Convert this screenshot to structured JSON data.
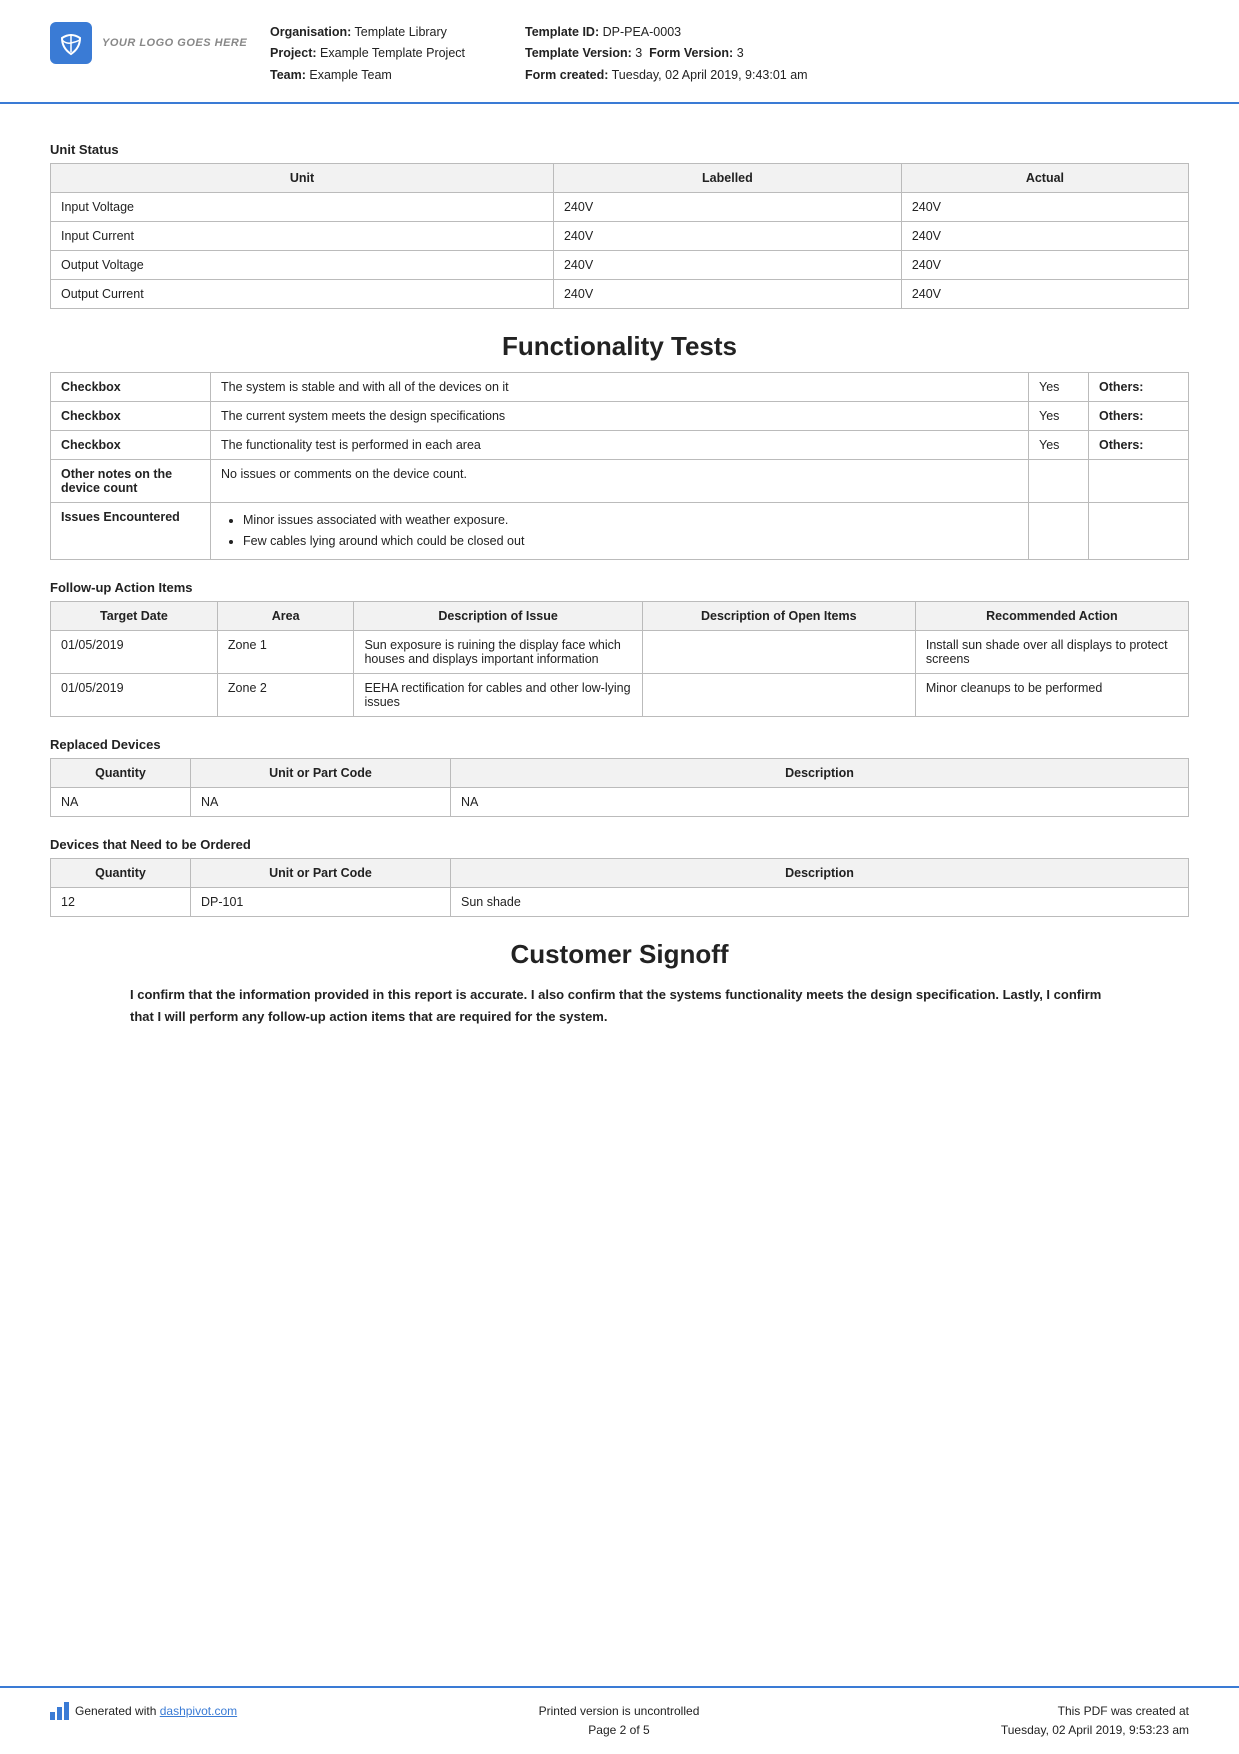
{
  "header": {
    "logo_text": "YOUR LOGO GOES HERE",
    "org_label": "Organisation:",
    "org_value": "Template Library",
    "project_label": "Project:",
    "project_value": "Example Template Project",
    "team_label": "Team:",
    "team_value": "Example Team",
    "template_id_label": "Template ID:",
    "template_id_value": "DP-PEA-0003",
    "template_version_label": "Template Version:",
    "template_version_value": "3",
    "form_version_label": "Form Version:",
    "form_version_value": "3",
    "form_created_label": "Form created:",
    "form_created_value": "Tuesday, 02 April 2019, 9:43:01 am"
  },
  "unit_status": {
    "section_title": "Unit Status",
    "columns": [
      "Unit",
      "Labelled",
      "Actual"
    ],
    "rows": [
      [
        "Input Voltage",
        "240V",
        "240V"
      ],
      [
        "Input Current",
        "240V",
        "240V"
      ],
      [
        "Output Voltage",
        "240V",
        "240V"
      ],
      [
        "Output Current",
        "240V",
        "240V"
      ]
    ]
  },
  "functionality_tests": {
    "heading": "Functionality Tests",
    "rows": [
      {
        "label": "Checkbox",
        "description": "The system is stable and with all of the devices on it",
        "value": "Yes",
        "others_label": "Others:"
      },
      {
        "label": "Checkbox",
        "description": "The current system meets the design specifications",
        "value": "Yes",
        "others_label": "Others:"
      },
      {
        "label": "Checkbox",
        "description": "The functionality test is performed in each area",
        "value": "Yes",
        "others_label": "Others:"
      },
      {
        "label": "Other notes on the device count",
        "description": "No issues or comments on the device count.",
        "value": "",
        "others_label": ""
      },
      {
        "label": "Issues Encountered",
        "description": "",
        "value": "",
        "others_label": "",
        "bullets": [
          "Minor issues associated with weather exposure.",
          "Few cables lying around which could be closed out"
        ]
      }
    ]
  },
  "followup": {
    "section_title": "Follow-up Action Items",
    "columns": [
      "Target Date",
      "Area",
      "Description of Issue",
      "Description of Open Items",
      "Recommended Action"
    ],
    "rows": [
      {
        "date": "01/05/2019",
        "area": "Zone 1",
        "issue": "Sun exposure is ruining the display face which houses and displays important information",
        "open_items": "",
        "action": "Install sun shade over all displays to protect screens"
      },
      {
        "date": "01/05/2019",
        "area": "Zone 2",
        "issue": "EEHA rectification for cables and other low-lying issues",
        "open_items": "",
        "action": "Minor cleanups to be performed"
      }
    ]
  },
  "replaced_devices": {
    "section_title": "Replaced Devices",
    "columns": [
      "Quantity",
      "Unit or Part Code",
      "Description"
    ],
    "rows": [
      [
        "NA",
        "NA",
        "NA"
      ]
    ]
  },
  "devices_to_order": {
    "section_title": "Devices that Need to be Ordered",
    "columns": [
      "Quantity",
      "Unit or Part Code",
      "Description"
    ],
    "rows": [
      [
        "12",
        "DP-101",
        "Sun shade"
      ]
    ]
  },
  "customer_signoff": {
    "heading": "Customer Signoff",
    "text": "I confirm that the information provided in this report is accurate. I also confirm that the systems functionality meets the design specification. Lastly, I confirm that I will perform any follow-up action items that are required for the system."
  },
  "footer": {
    "generated_text": "Generated with",
    "brand_link": "dashpivot.com",
    "center_line1": "Printed version is uncontrolled",
    "center_line2": "Page 2 of 5",
    "right_line1": "This PDF was created at",
    "right_line2": "Tuesday, 02 April 2019, 9:53:23 am"
  }
}
